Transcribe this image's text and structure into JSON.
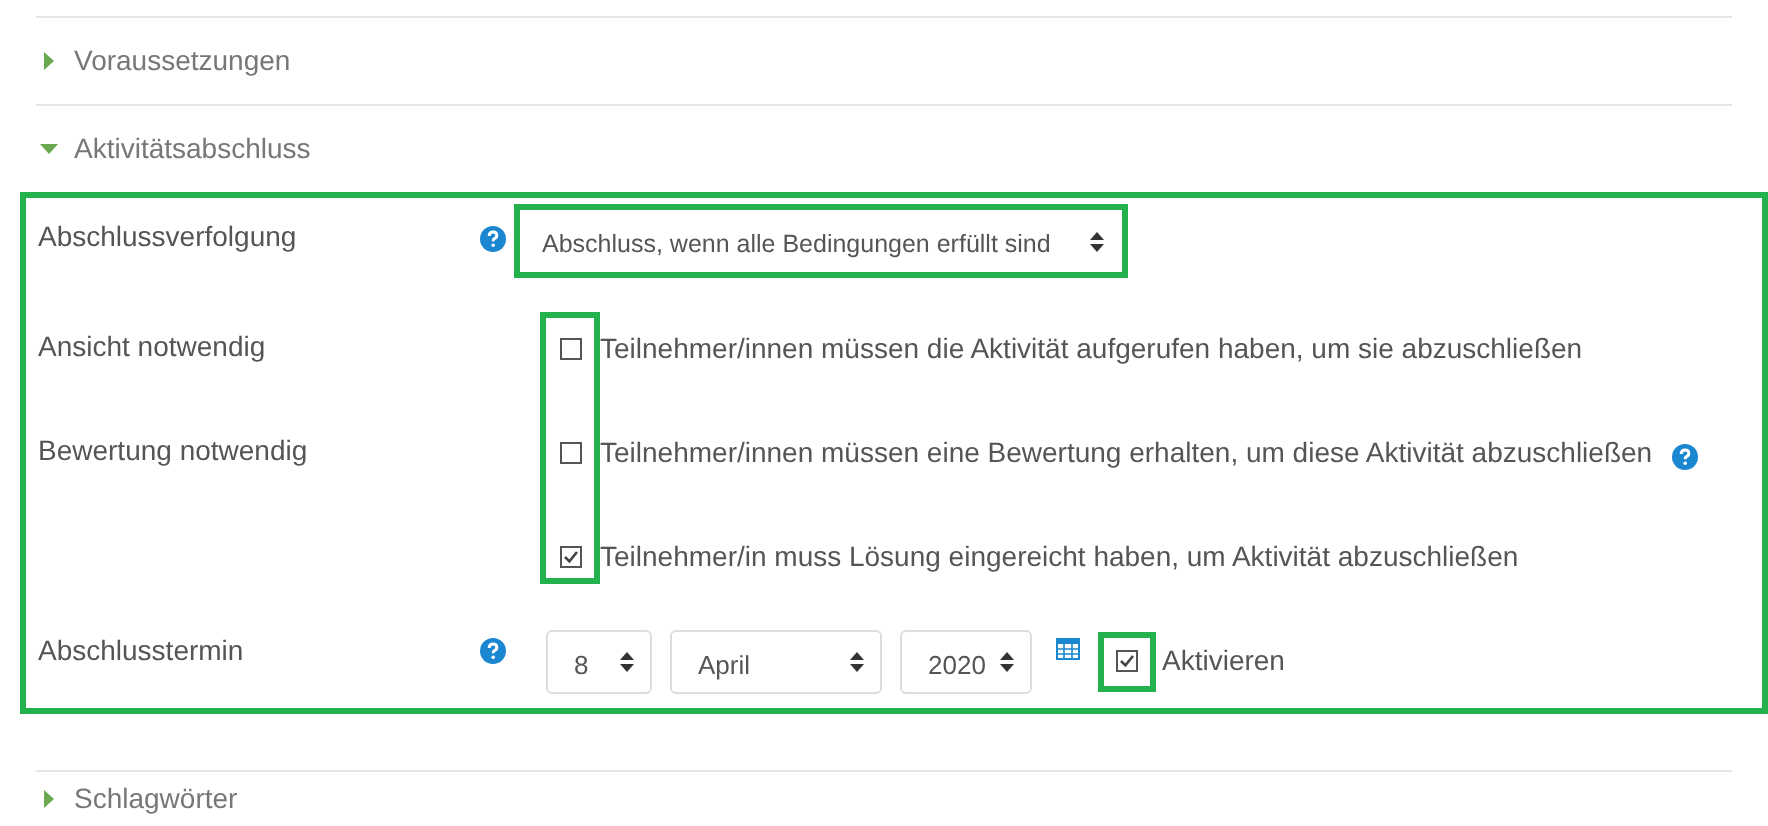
{
  "sections_before": [
    {
      "title": "Voraussetzungen",
      "expanded": false
    },
    {
      "title": "Aktivitätsabschluss",
      "expanded": true
    }
  ],
  "completion": {
    "tracking": {
      "label": "Abschlussverfolgung",
      "help": true,
      "value": "Abschluss, wenn alle Bedingungen erfüllt sind"
    },
    "conditions": [
      {
        "label": "Ansicht notwendig",
        "text": "Teilnehmer/innen müssen die Aktivität aufgerufen haben, um sie abzuschließen",
        "checked": false,
        "help": false
      },
      {
        "label": "Bewertung notwendig",
        "text": "Teilnehmer/innen müssen eine Bewertung erhalten, um diese Aktivität abzuschließen",
        "checked": false,
        "help": true
      },
      {
        "text": "Teilnehmer/in muss Lösung eingereicht haben, um Aktivität abzuschließen",
        "checked": true,
        "help": false
      }
    ],
    "date": {
      "label": "Abschlusstermin",
      "help": true,
      "day": "8",
      "month": "April",
      "year": "2020",
      "enable_label": "Aktivieren",
      "enabled": true
    }
  },
  "sections_after": [
    {
      "title": "Schlagwörter",
      "expanded": false
    }
  ]
}
